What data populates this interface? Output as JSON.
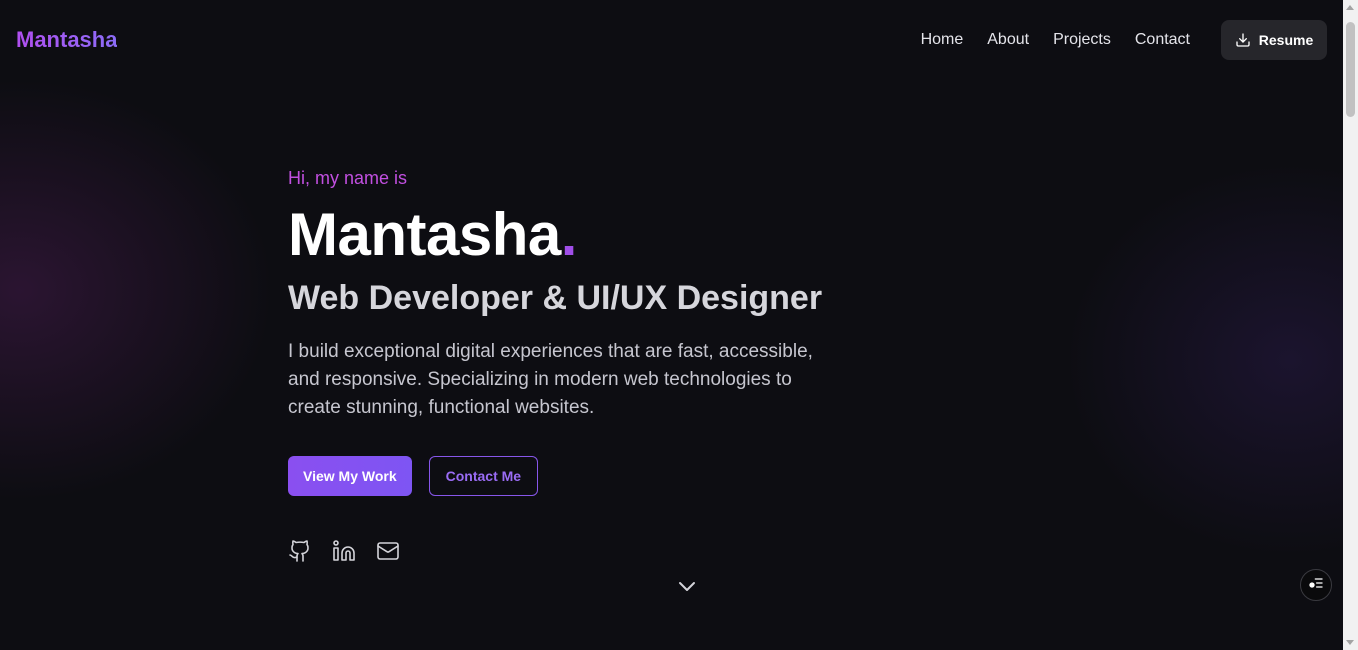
{
  "header": {
    "logo": "Mantasha",
    "nav": [
      "Home",
      "About",
      "Projects",
      "Contact"
    ],
    "resume_label": "Resume"
  },
  "hero": {
    "greeting": "Hi, my name is",
    "name": "Mantasha",
    "name_suffix": ".",
    "role": "Web Developer & UI/UX Designer",
    "description": "I build exceptional digital experiences that are fast, accessible, and responsive. Specializing in modern web technologies to create stunning, functional websites.",
    "primary_button": "View My Work",
    "secondary_button": "Contact Me"
  },
  "social_icons": [
    "github-icon",
    "linkedin-icon",
    "mail-icon"
  ],
  "colors": {
    "accent": "#8a4ff0",
    "greeting": "#c14fe0",
    "background": "#0d0d12"
  }
}
